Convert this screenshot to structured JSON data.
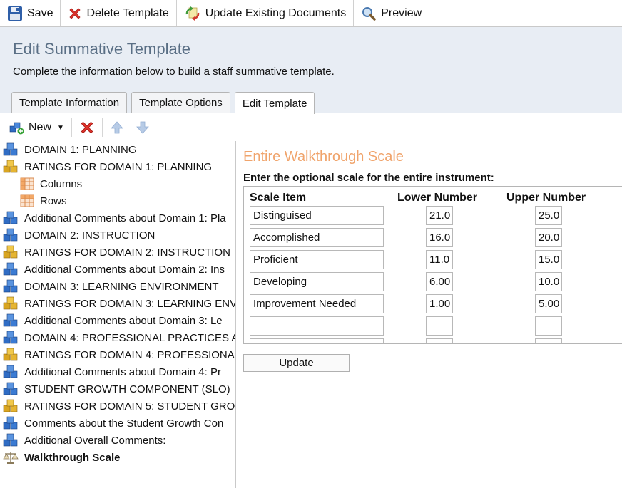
{
  "toolbar": {
    "save": "Save",
    "delete_template": "Delete Template",
    "update_existing": "Update Existing Documents",
    "preview": "Preview"
  },
  "header": {
    "title": "Edit Summative Template",
    "subtitle": "Complete the information below to build a staff summative template.",
    "tabs": [
      {
        "label": "Template Information",
        "active": false
      },
      {
        "label": "Template Options",
        "active": false
      },
      {
        "label": "Edit Template",
        "active": true
      }
    ]
  },
  "subtoolbar": {
    "new_label": "New"
  },
  "tree": {
    "items": [
      {
        "label": "DOMAIN 1: PLANNING",
        "icon": "blue-blocks-icon"
      },
      {
        "label": "RATINGS FOR DOMAIN 1: PLANNING",
        "icon": "gold-blocks-icon"
      },
      {
        "label": "Columns",
        "icon": "grid-columns-icon",
        "child": true
      },
      {
        "label": "Rows",
        "icon": "grid-rows-icon",
        "child": true
      },
      {
        "label": "Additional Comments about Domain 1: Pla",
        "icon": "blue-blocks-icon"
      },
      {
        "label": "DOMAIN 2: INSTRUCTION",
        "icon": "blue-blocks-icon"
      },
      {
        "label": "RATINGS FOR DOMAIN 2: INSTRUCTION",
        "icon": "gold-blocks-icon"
      },
      {
        "label": "Additional Comments about Domain 2: Ins",
        "icon": "blue-blocks-icon"
      },
      {
        "label": "DOMAIN 3: LEARNING ENVIRONMENT",
        "icon": "blue-blocks-icon"
      },
      {
        "label": "RATINGS FOR DOMAIN 3: LEARNING ENV",
        "icon": "gold-blocks-icon"
      },
      {
        "label": "Additional Comments about Domain 3: Le",
        "icon": "blue-blocks-icon"
      },
      {
        "label": "DOMAIN 4: PROFESSIONAL PRACTICES A",
        "icon": "blue-blocks-icon"
      },
      {
        "label": "RATINGS FOR DOMAIN 4: PROFESSIONAL",
        "icon": "gold-blocks-icon"
      },
      {
        "label": "Additional Comments about Domain 4: Pr",
        "icon": "blue-blocks-icon"
      },
      {
        "label": "STUDENT GROWTH COMPONENT (SLO)",
        "icon": "blue-blocks-icon"
      },
      {
        "label": "RATINGS FOR DOMAIN 5: STUDENT GRO",
        "icon": "gold-blocks-icon"
      },
      {
        "label": "Comments about the Student Growth Con",
        "icon": "blue-blocks-icon"
      },
      {
        "label": "Additional Overall Comments:",
        "icon": "blue-blocks-icon"
      },
      {
        "label": "Walkthrough Scale",
        "icon": "scale-icon",
        "bold": true
      }
    ]
  },
  "panel": {
    "title": "Entire Walkthrough Scale",
    "instruction": "Enter the optional scale for the entire instrument:",
    "headers": {
      "item": "Scale Item",
      "lower": "Lower Number",
      "upper": "Upper Number"
    },
    "rows": [
      {
        "item": "Distinguised",
        "lower": "21.0",
        "upper": "25.0"
      },
      {
        "item": "Accomplished",
        "lower": "16.0",
        "upper": "20.0"
      },
      {
        "item": "Proficient",
        "lower": "11.0",
        "upper": "15.0"
      },
      {
        "item": "Developing",
        "lower": "6.00",
        "upper": "10.0"
      },
      {
        "item": "Improvement Needed",
        "lower": "1.00",
        "upper": "5.00"
      },
      {
        "item": "",
        "lower": "",
        "upper": ""
      },
      {
        "item": "",
        "lower": "",
        "upper": ""
      }
    ],
    "update_label": "Update"
  },
  "colors": {
    "panel_title": "#f0a46c",
    "page_title": "#5a6f85",
    "header_bg": "#e8edf4"
  }
}
